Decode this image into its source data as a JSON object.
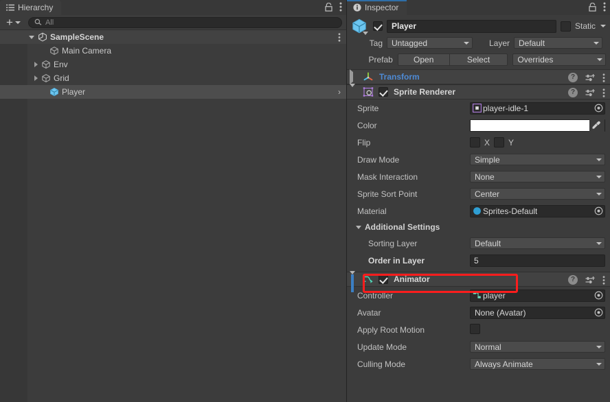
{
  "hierarchy": {
    "tab_label": "Hierarchy",
    "tab_icon": "hierarchy-list-icon",
    "add_button_label": "+",
    "search": {
      "placeholder": "All",
      "value": "",
      "icon": "search-icon"
    },
    "rows": [
      {
        "label": "SampleScene",
        "icon": "unity-scene-icon",
        "depth": 0,
        "expanded": true,
        "has_children": true,
        "selected": false,
        "kebab": true
      },
      {
        "label": "Main Camera",
        "icon": "gameobject-cube-icon",
        "depth": 1,
        "expanded": false,
        "has_children": false,
        "selected": false,
        "kebab": false
      },
      {
        "label": "Env",
        "icon": "gameobject-cube-icon",
        "depth": 1,
        "expanded": false,
        "has_children": true,
        "selected": false,
        "kebab": false
      },
      {
        "label": "Grid",
        "icon": "gameobject-cube-icon",
        "depth": 1,
        "expanded": false,
        "has_children": true,
        "selected": false,
        "kebab": false
      },
      {
        "label": "Player",
        "icon": "prefab-cube-icon",
        "depth": 1,
        "expanded": false,
        "has_children": false,
        "selected": true,
        "kebab": false,
        "chevron": "›"
      }
    ]
  },
  "inspector": {
    "tab_label": "Inspector",
    "tab_icon": "info-circle-icon",
    "object": {
      "enabled": true,
      "name": "Player",
      "static_label": "Static",
      "static_checked": false,
      "tag_label": "Tag",
      "tag_value": "Untagged",
      "layer_label": "Layer",
      "layer_value": "Default",
      "prefab_label": "Prefab",
      "open_label": "Open",
      "select_label": "Select",
      "overrides_label": "Overrides"
    },
    "components": [
      {
        "name": "Transform",
        "icon": "transform-gizmo-icon",
        "expanded": false,
        "has_toggle": false,
        "title_is_link": true
      },
      {
        "name": "Sprite Renderer",
        "icon": "sprite-renderer-icon",
        "expanded": true,
        "has_toggle": true,
        "enabled": true,
        "title_is_link": false,
        "properties": [
          {
            "label": "Sprite",
            "type": "object",
            "value": "player-idle-1",
            "value_icon": "sprite-asset-icon"
          },
          {
            "label": "Color",
            "type": "color",
            "value": "#ffffff",
            "swatch": "#ffffff"
          },
          {
            "label": "Flip",
            "type": "flip",
            "x_label": "X",
            "y_label": "Y",
            "x_checked": false,
            "y_checked": false
          },
          {
            "label": "Draw Mode",
            "type": "dropdown",
            "value": "Simple"
          },
          {
            "label": "Mask Interaction",
            "type": "dropdown",
            "value": "None"
          },
          {
            "label": "Sprite Sort Point",
            "type": "dropdown",
            "value": "Center"
          },
          {
            "label": "Material",
            "type": "object",
            "value": "Sprites-Default",
            "value_icon": "material-sphere-icon"
          }
        ],
        "subsection": {
          "title": "Additional Settings",
          "expanded": true,
          "properties": [
            {
              "label": "Sorting Layer",
              "type": "dropdown",
              "value": "Default",
              "highlighted": false
            },
            {
              "label": "Order in Layer",
              "type": "number",
              "value": "5",
              "highlighted": true,
              "modified": true
            }
          ]
        }
      },
      {
        "name": "Animator",
        "icon": "animator-icon",
        "expanded": true,
        "has_toggle": true,
        "enabled": true,
        "title_is_link": false,
        "properties": [
          {
            "label": "Controller",
            "type": "object",
            "value": "player",
            "value_icon": "animator-controller-icon"
          },
          {
            "label": "Avatar",
            "type": "object",
            "value": "None (Avatar)",
            "value_icon": ""
          },
          {
            "label": "Apply Root Motion",
            "type": "checkbox",
            "checked": false
          },
          {
            "label": "Update Mode",
            "type": "dropdown",
            "value": "Normal"
          },
          {
            "label": "Culling Mode",
            "type": "dropdown",
            "value": "Always Animate"
          }
        ]
      }
    ]
  },
  "colors": {
    "panel_bg": "#3c3c3c",
    "window_bg": "#383838",
    "header_bg": "#424242",
    "selection": "#4d4d4d",
    "accent_blue": "#4e8ad4",
    "highlight_red": "#fe1d1d",
    "modified_bar": "#3b7fc4"
  }
}
